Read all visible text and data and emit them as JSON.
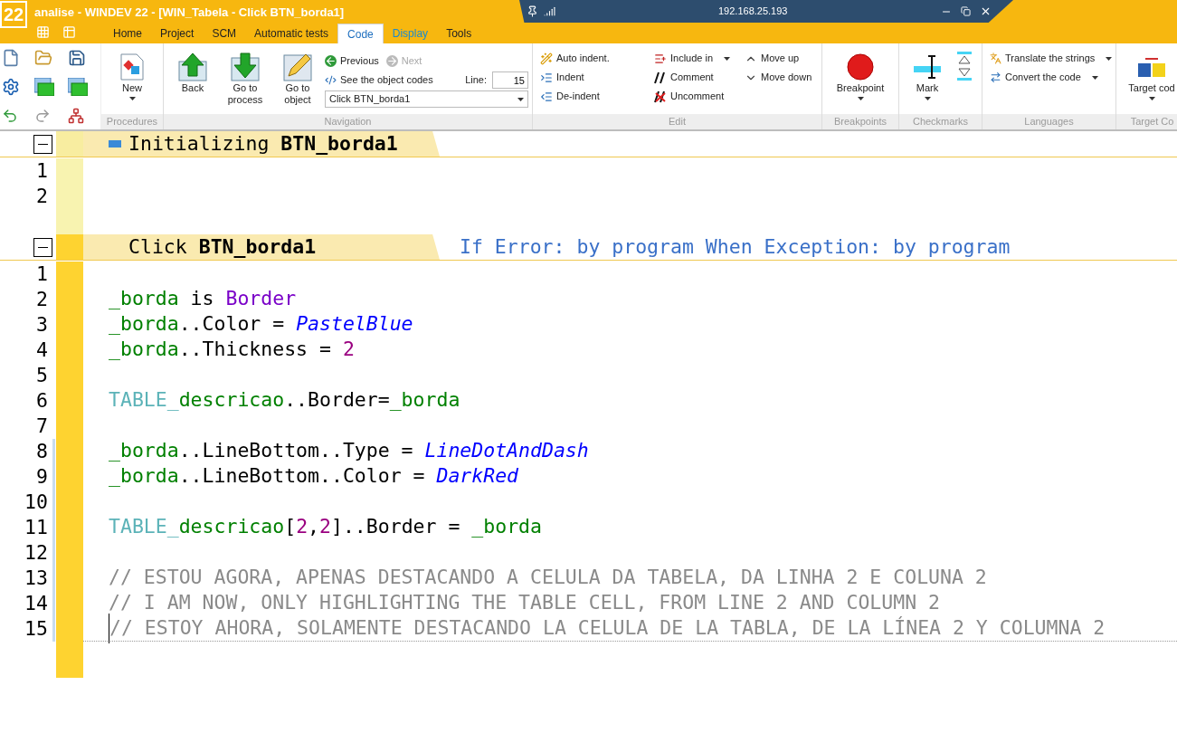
{
  "window": {
    "logo": "22",
    "title": "analise - WINDEV 22 - [WIN_Tabela - Click BTN_borda1]"
  },
  "remote_bar": {
    "address": "192.168.25.193"
  },
  "tabs": [
    {
      "label": "Home",
      "selected": false,
      "accent": false
    },
    {
      "label": "Project",
      "selected": false,
      "accent": false
    },
    {
      "label": "SCM",
      "selected": false,
      "accent": false
    },
    {
      "label": "Automatic tests",
      "selected": false,
      "accent": false
    },
    {
      "label": "Code",
      "selected": true,
      "accent": false
    },
    {
      "label": "Display",
      "selected": false,
      "accent": true
    },
    {
      "label": "Tools",
      "selected": false,
      "accent": false
    }
  ],
  "ribbon": {
    "procedures": {
      "label": "Procedures",
      "new_button": {
        "label": "New",
        "menu": true
      }
    },
    "navigation": {
      "label": "Navigation",
      "large_buttons": [
        {
          "label": "Back"
        },
        {
          "label": "Go to process"
        },
        {
          "label": "Go to object"
        }
      ],
      "previous": {
        "label": "Previous",
        "disabled": false
      },
      "next": {
        "label": "Next",
        "disabled": true
      },
      "object_codes": "See the object codes",
      "line_field": {
        "label": "Line:",
        "value": "15"
      },
      "object_dropdown": {
        "value": "Click BTN_borda1"
      }
    },
    "edit": {
      "label": "Edit",
      "columns": [
        [
          {
            "label": "Auto indent.",
            "menu": false
          },
          {
            "label": "Indent",
            "menu": false
          },
          {
            "label": "De-indent",
            "menu": false
          }
        ],
        [
          {
            "label": "Include in",
            "menu": true
          },
          {
            "label": "Comment",
            "menu": false
          },
          {
            "label": "Uncomment",
            "menu": false
          }
        ],
        [
          {
            "label": "Move up",
            "menu": false
          },
          {
            "label": "Move down",
            "menu": false
          }
        ]
      ]
    },
    "breakpoints": {
      "label": "Breakpoints",
      "button": {
        "label": "Breakpoint",
        "menu": true
      }
    },
    "checkmarks": {
      "label": "Checkmarks",
      "button": {
        "label": "Mark",
        "menu": true
      }
    },
    "languages": {
      "label": "Languages",
      "items": [
        {
          "label": "Translate the strings",
          "menu": true
        },
        {
          "label": "Convert the code",
          "menu": true
        }
      ]
    },
    "target_code": {
      "label": "Target Co",
      "button": {
        "label": "Target cod",
        "menu": true
      }
    }
  },
  "editor": {
    "sections": [
      {
        "prefix": "Initializing",
        "object": "BTN_borda1",
        "expanded": true,
        "active": false,
        "lines": [
          {
            "number": "1"
          },
          {
            "number": "2"
          }
        ]
      },
      {
        "prefix": "Click",
        "object": "BTN_borda1",
        "expanded": true,
        "active": true,
        "note": "If Error: by program When Exception: by program",
        "lines": [
          {
            "number": "1"
          },
          {
            "number": "2",
            "current": false,
            "tokens": [
              {
                "kind": "var",
                "text": "_borda"
              },
              {
                "kind": "plain",
                "text": " is "
              },
              {
                "kind": "type",
                "text": "Border"
              }
            ]
          },
          {
            "number": "3",
            "current": false,
            "tokens": [
              {
                "kind": "var",
                "text": "_borda"
              },
              {
                "kind": "plain",
                "text": "..Color = "
              },
              {
                "kind": "const",
                "text": "PastelBlue"
              }
            ]
          },
          {
            "number": "4",
            "current": false,
            "tokens": [
              {
                "kind": "var",
                "text": "_borda"
              },
              {
                "kind": "plain",
                "text": "..Thickness = "
              },
              {
                "kind": "num",
                "text": "2"
              }
            ]
          },
          {
            "number": "5"
          },
          {
            "number": "6",
            "current": false,
            "tokens": [
              {
                "kind": "table",
                "text": "TABLE_"
              },
              {
                "kind": "var",
                "text": "descricao"
              },
              {
                "kind": "plain",
                "text": "..Border="
              },
              {
                "kind": "var",
                "text": "_borda"
              }
            ]
          },
          {
            "number": "7"
          },
          {
            "number": "8",
            "modified": true,
            "current": false,
            "tokens": [
              {
                "kind": "var",
                "text": "_borda"
              },
              {
                "kind": "plain",
                "text": "..LineBottom..Type = "
              },
              {
                "kind": "const",
                "text": "LineDotAndDash"
              }
            ]
          },
          {
            "number": "9",
            "modified": true,
            "current": false,
            "tokens": [
              {
                "kind": "var",
                "text": "_borda"
              },
              {
                "kind": "plain",
                "text": "..LineBottom..Color = "
              },
              {
                "kind": "const",
                "text": "DarkRed"
              }
            ]
          },
          {
            "number": "10",
            "modified": true
          },
          {
            "number": "11",
            "modified": true,
            "current": false,
            "tokens": [
              {
                "kind": "table",
                "text": "TABLE_"
              },
              {
                "kind": "var",
                "text": "descricao"
              },
              {
                "kind": "plain",
                "text": "["
              },
              {
                "kind": "num",
                "text": "2"
              },
              {
                "kind": "plain",
                "text": ","
              },
              {
                "kind": "num",
                "text": "2"
              },
              {
                "kind": "plain",
                "text": "]..Border = "
              },
              {
                "kind": "var",
                "text": "_borda"
              }
            ]
          },
          {
            "number": "12",
            "modified": true
          },
          {
            "number": "13",
            "modified": true,
            "current": false,
            "tokens": [
              {
                "kind": "comment",
                "text": "// ESTOU AGORA, APENAS DESTACANDO A CELULA DA TABELA, DA LINHA 2 E COLUNA 2"
              }
            ]
          },
          {
            "number": "14",
            "modified": true,
            "current": false,
            "tokens": [
              {
                "kind": "comment",
                "text": "// I AM NOW, ONLY HIGHLIGHTING THE TABLE CELL, FROM LINE 2 AND COLUMN 2"
              }
            ]
          },
          {
            "number": "15",
            "modified": true,
            "current": true,
            "tokens": [
              {
                "kind": "comment",
                "text": "// ESTOY AHORA, SOLAMENTE DESTACANDO LA CELULA DE LA TABLA, DE LA LÍNEA 2 Y COLUMNA 2"
              }
            ]
          }
        ]
      }
    ]
  }
}
